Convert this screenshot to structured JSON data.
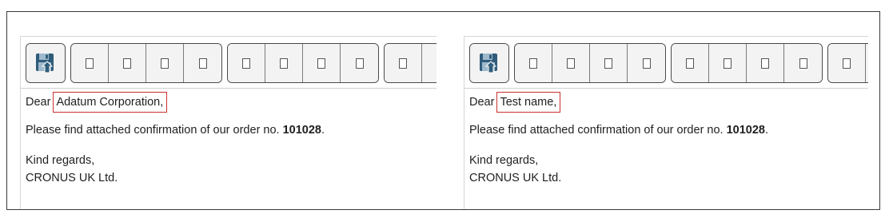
{
  "editors": [
    {
      "greeting": "Dear",
      "recipient": "Adatum Corporation,",
      "body_prefix": "Please find attached confirmation of our order no.",
      "order_no": "101028",
      "body_suffix": ".",
      "closing": "Kind regards,",
      "signature": "CRONUS UK Ltd."
    },
    {
      "greeting": "Dear",
      "recipient": "Test name,",
      "body_prefix": "Please find attached confirmation of our order no.",
      "order_no": "101028",
      "body_suffix": ".",
      "closing": "Kind regards,",
      "signature": "CRONUS UK Ltd."
    }
  ],
  "toolbar": {
    "save_icon": "save-icon",
    "placeholder_icon": "empty-box-icon",
    "colors": {
      "save_icon_dark": "#2f5c7a",
      "save_icon_light": "#9fb9cc",
      "highlight_border": "#c8302f"
    }
  }
}
